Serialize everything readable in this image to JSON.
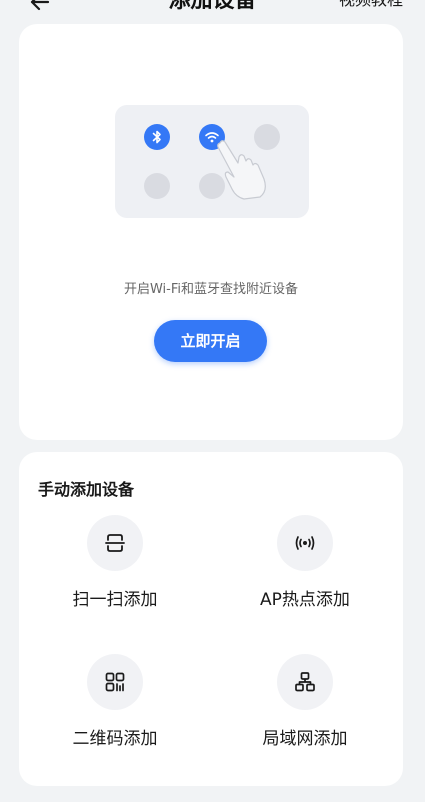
{
  "header": {
    "title": "添加设备",
    "video_label": "视频教程",
    "back_icon": "arrow-left-icon"
  },
  "discover": {
    "hint": "开启Wi-Fi和蓝牙查找附近设备",
    "button_label": "立即开启",
    "accent_color": "#3478f6"
  },
  "manual": {
    "title": "手动添加设备",
    "options": [
      {
        "label": "扫一扫添加",
        "icon": "scan-icon"
      },
      {
        "label": "AP热点添加",
        "icon": "hotspot-icon"
      },
      {
        "label": "二维码添加",
        "icon": "qrcode-icon"
      },
      {
        "label": "局域网添加",
        "icon": "lan-icon"
      }
    ]
  }
}
